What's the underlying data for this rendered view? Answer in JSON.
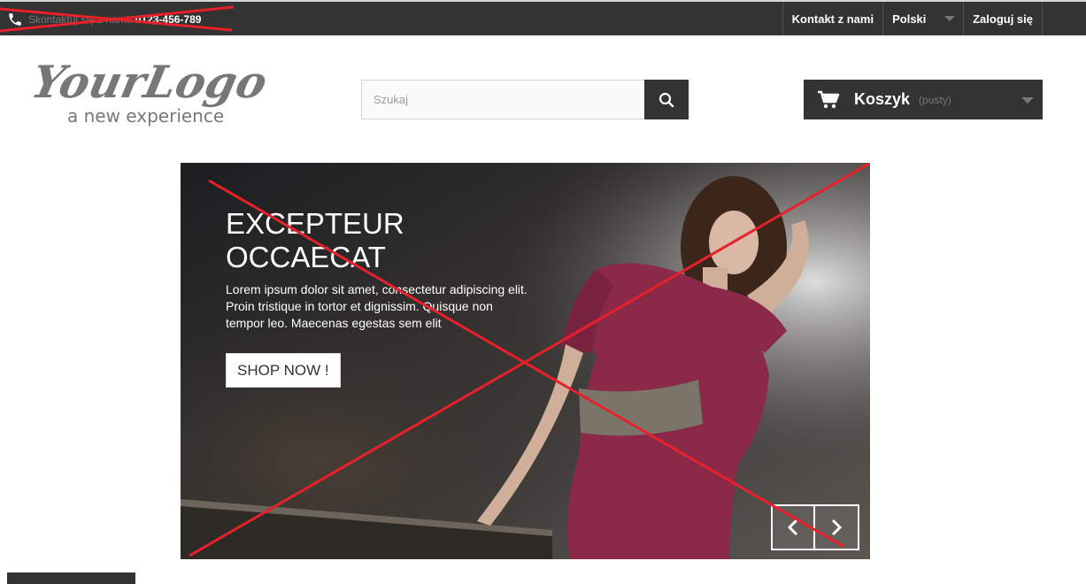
{
  "topbar": {
    "contact_text": "Skontaktuj się z nami:",
    "contact_phone": "0123-456-789",
    "nav": [
      {
        "label": "Kontakt z nami"
      },
      {
        "label": "Polski"
      },
      {
        "label": "Zaloguj się"
      }
    ]
  },
  "header": {
    "logo_main": "YourLogo",
    "logo_tagline": "a new experience",
    "search": {
      "placeholder": "Szukaj"
    },
    "cart": {
      "label": "Koszyk",
      "status": "(pusty)"
    }
  },
  "slider": {
    "title_line1": "EXCEPTEUR",
    "title_line2": "OCCAECAT",
    "text": "Lorem ipsum dolor sit amet, consectetur adipiscing elit. Proin tristique in tortor et dignissim. Quisque non tempor leo. Maecenas egestas sem elit",
    "button_label": "SHOP NOW !"
  },
  "colors": {
    "dark": "#333333",
    "strike_red": "#e8202a",
    "dress": "#8a2a48"
  },
  "icons": [
    "phone-icon",
    "search-icon",
    "cart-icon",
    "chevron-left-icon",
    "chevron-right-icon",
    "caret-down-icon"
  ]
}
